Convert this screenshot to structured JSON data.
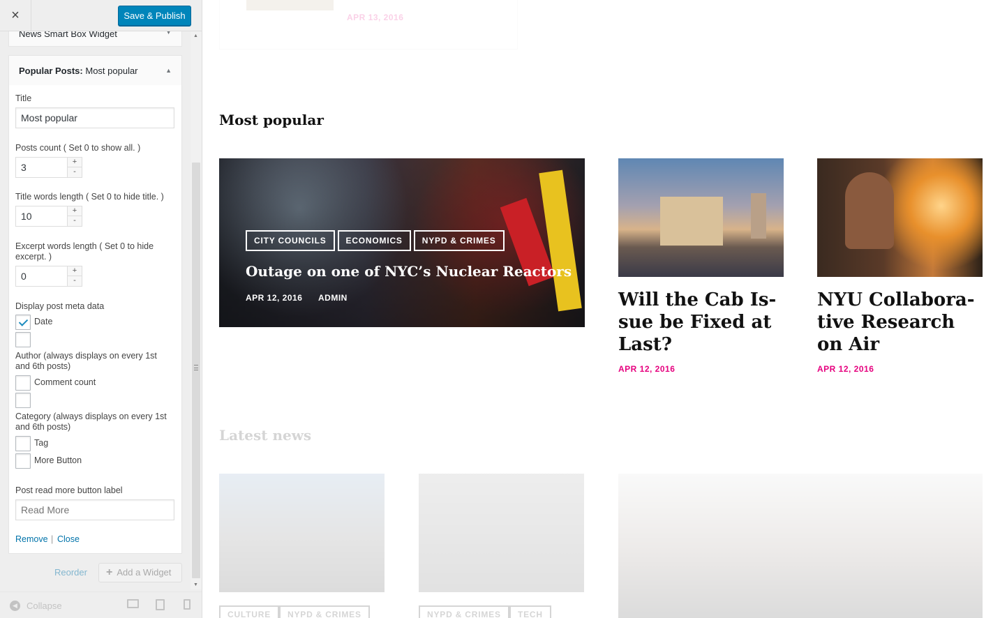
{
  "customizer": {
    "close_icon": "×",
    "publish_label": "Save & Publish",
    "prev_widget_title": "News Smart Box Widget",
    "widget": {
      "title_prefix": "Popular Posts:",
      "title_suffix": " Most popular",
      "fields": {
        "title_label": "Title",
        "title_value": "Most popular",
        "posts_count_label": "Posts count ( Set 0 to show all. )",
        "posts_count_value": "3",
        "title_words_label": "Title words length ( Set 0 to hide title. )",
        "title_words_value": "10",
        "excerpt_words_label": "Excerpt words length ( Set 0 to hide excerpt. )",
        "excerpt_words_value": "0",
        "meta_label": "Display post meta data",
        "meta_date": "Date",
        "meta_author": "Author (always displays on every 1st and 6th posts)",
        "meta_comment": "Comment count",
        "meta_category": "Category (always displays on every 1st and 6th posts)",
        "meta_tag": "Tag",
        "meta_more": "More Button",
        "read_more_label": "Post read more button label",
        "read_more_placeholder": "Read More"
      },
      "remove_link": "Remove",
      "separator": "|",
      "close_link": "Close"
    },
    "reorder_label": "Reorder",
    "add_widget_label": "Add a Widget",
    "collapse_label": "Collapse"
  },
  "preview": {
    "top_card_date": "APR 13, 2016",
    "section_title": "Most popular",
    "hero": {
      "tags": [
        "CITY COUNCILS",
        "ECONOMICS",
        "NYPD & CRIMES"
      ],
      "title": "Outage on one of NYC’s Nuclear Reactors",
      "date": "APR 12, 2016",
      "author": "ADMIN"
    },
    "cards": [
      {
        "title": "Will the Cab Is- sue be Fixed at Last?",
        "date": "APR 12, 2016"
      },
      {
        "title": "NYU Collabora- tive Research on Air",
        "date": "APR 12, 2016"
      }
    ],
    "latest_title": "Latest news",
    "latest_tags_1": [
      "CULTURE",
      "NYPD & CRIMES"
    ],
    "latest_tags_2": [
      "NYPD & CRIMES",
      "TECH"
    ]
  },
  "colors": {
    "accent": "#e6007e",
    "publish": "#0085ba",
    "link": "#0073aa"
  }
}
